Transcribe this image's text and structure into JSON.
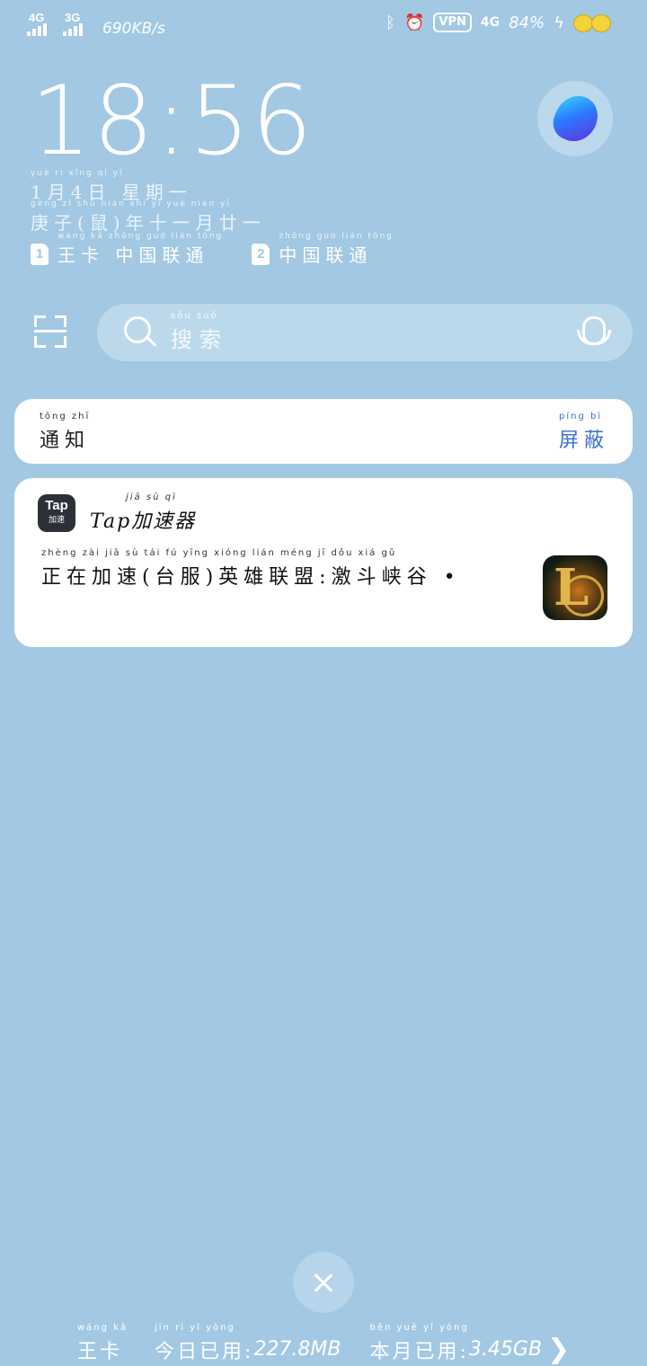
{
  "status_bar": {
    "sim1_network": "4G",
    "sim2_network": "3G",
    "net_speed": "690KB/s",
    "vpn": "VPN",
    "data_net": "4G",
    "battery": "84%"
  },
  "clock": {
    "time": "18:56"
  },
  "date": {
    "line": "1月4日 星期一",
    "line_pinyin": "yuè   rì  xīng qī  yī",
    "lunar": "庚子(鼠)年十一月廿一",
    "lunar_pinyin": "gēng zǐ  shǔ  nián shí yī yuè niàn yī"
  },
  "sims": {
    "sim1_index": "1",
    "sim1_name": "王卡 中国联通",
    "sim1_pinyin": "wáng kǎ zhōng guó lián tōng",
    "sim2_index": "2",
    "sim2_name": "中国联通",
    "sim2_pinyin": "zhōng guó lián tōng"
  },
  "search": {
    "placeholder": "搜索",
    "placeholder_pinyin": "sōu suǒ"
  },
  "notifications": {
    "header": "通知",
    "header_pinyin": "tōng zhī",
    "mute": "屏蔽",
    "mute_pinyin": "píng bì",
    "items": [
      {
        "icon_text": "Tap",
        "icon_subtext": "加速",
        "app_name": "Tap加速器",
        "app_name_pinyin": "jiā sù qì",
        "message": "正在加速(台服)英雄联盟:激斗峡谷 •",
        "message_pinyin": "zhèng zài jiā  sù   tái  fú   yīng xióng lián méng  jī  dǒu xiá  gǔ"
      }
    ]
  },
  "data_usage": {
    "sim_name": "王卡",
    "sim_name_pinyin": "wáng kǎ",
    "today_label": "今日已用:",
    "today_pinyin": "jīn rì yǐ yòng",
    "today_value": "227.8MB",
    "month_label": "本月已用:",
    "month_pinyin": "běn yuè yǐ yòng",
    "month_value": "3.45GB",
    "more": "❯"
  }
}
